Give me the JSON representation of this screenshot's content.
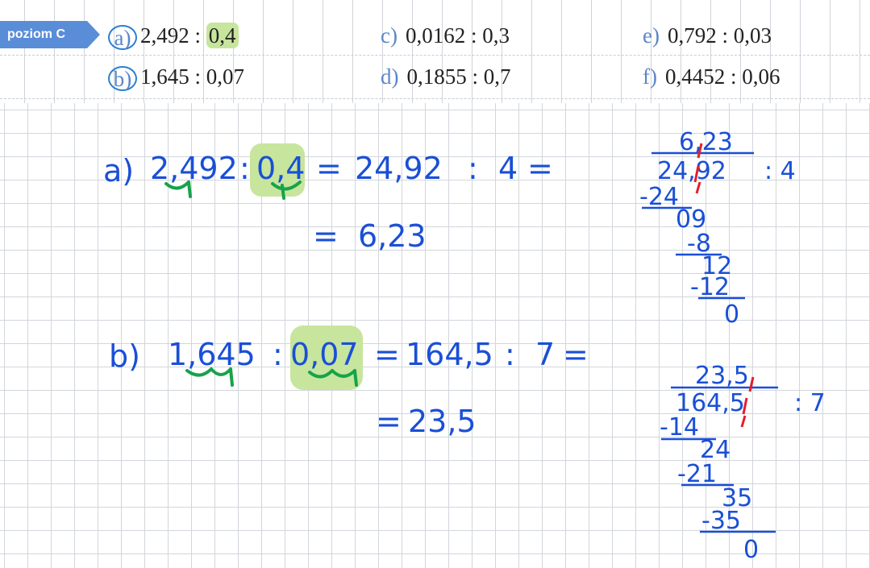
{
  "header": {
    "level_badge": "poziom C",
    "exercises": [
      {
        "label": "a)",
        "expr_main": "2,492 : ",
        "expr_highlight": "0,4",
        "circled": true
      },
      {
        "label": "b)",
        "expr_main": "1,645 : 0,07",
        "expr_highlight": "",
        "circled": true
      },
      {
        "label": "c)",
        "expr_main": "0,0162 : 0,3",
        "circled": false
      },
      {
        "label": "d)",
        "expr_main": "0,1855 : 0,7",
        "circled": false
      },
      {
        "label": "e)",
        "expr_main": "0,792 : 0,03",
        "circled": false
      },
      {
        "label": "f)",
        "expr_main": "0,4452 : 0,06",
        "circled": false
      }
    ]
  },
  "colors": {
    "ink": "#1a4fd6",
    "arrow_green": "#17a34a",
    "highlight": "#c7e59d",
    "comma_red": "#e41e2b",
    "badge": "#5a8dd8",
    "label_blue": "#5b86c9"
  },
  "solution_a": {
    "label": "a)",
    "n1": "2,492",
    "sep1": ":",
    "n2": "0,4",
    "eq1": "=",
    "n3": "24,92",
    "sep2": ":",
    "n4": "4",
    "eq2": "=",
    "eq3": "=",
    "result": "6,23",
    "long_division": {
      "quotient": "6,23",
      "dividend": "24,92",
      "divisor_part": ": 4",
      "steps": [
        "-24",
        "09",
        "-8",
        "12",
        "-12",
        "0"
      ]
    }
  },
  "solution_b": {
    "label": "b)",
    "n1": "1,645",
    "sep1": ":",
    "n2": "0,07",
    "eq1": "=",
    "n3": "164,5",
    "sep2": ":",
    "n4": "7",
    "eq2": "=",
    "eq3": "=",
    "result": "23,5",
    "long_division": {
      "quotient": "23,5",
      "dividend": "164,5",
      "divisor_part": ": 7",
      "steps": [
        "-14",
        "24",
        "-21",
        "35",
        "-35",
        "0"
      ]
    }
  }
}
